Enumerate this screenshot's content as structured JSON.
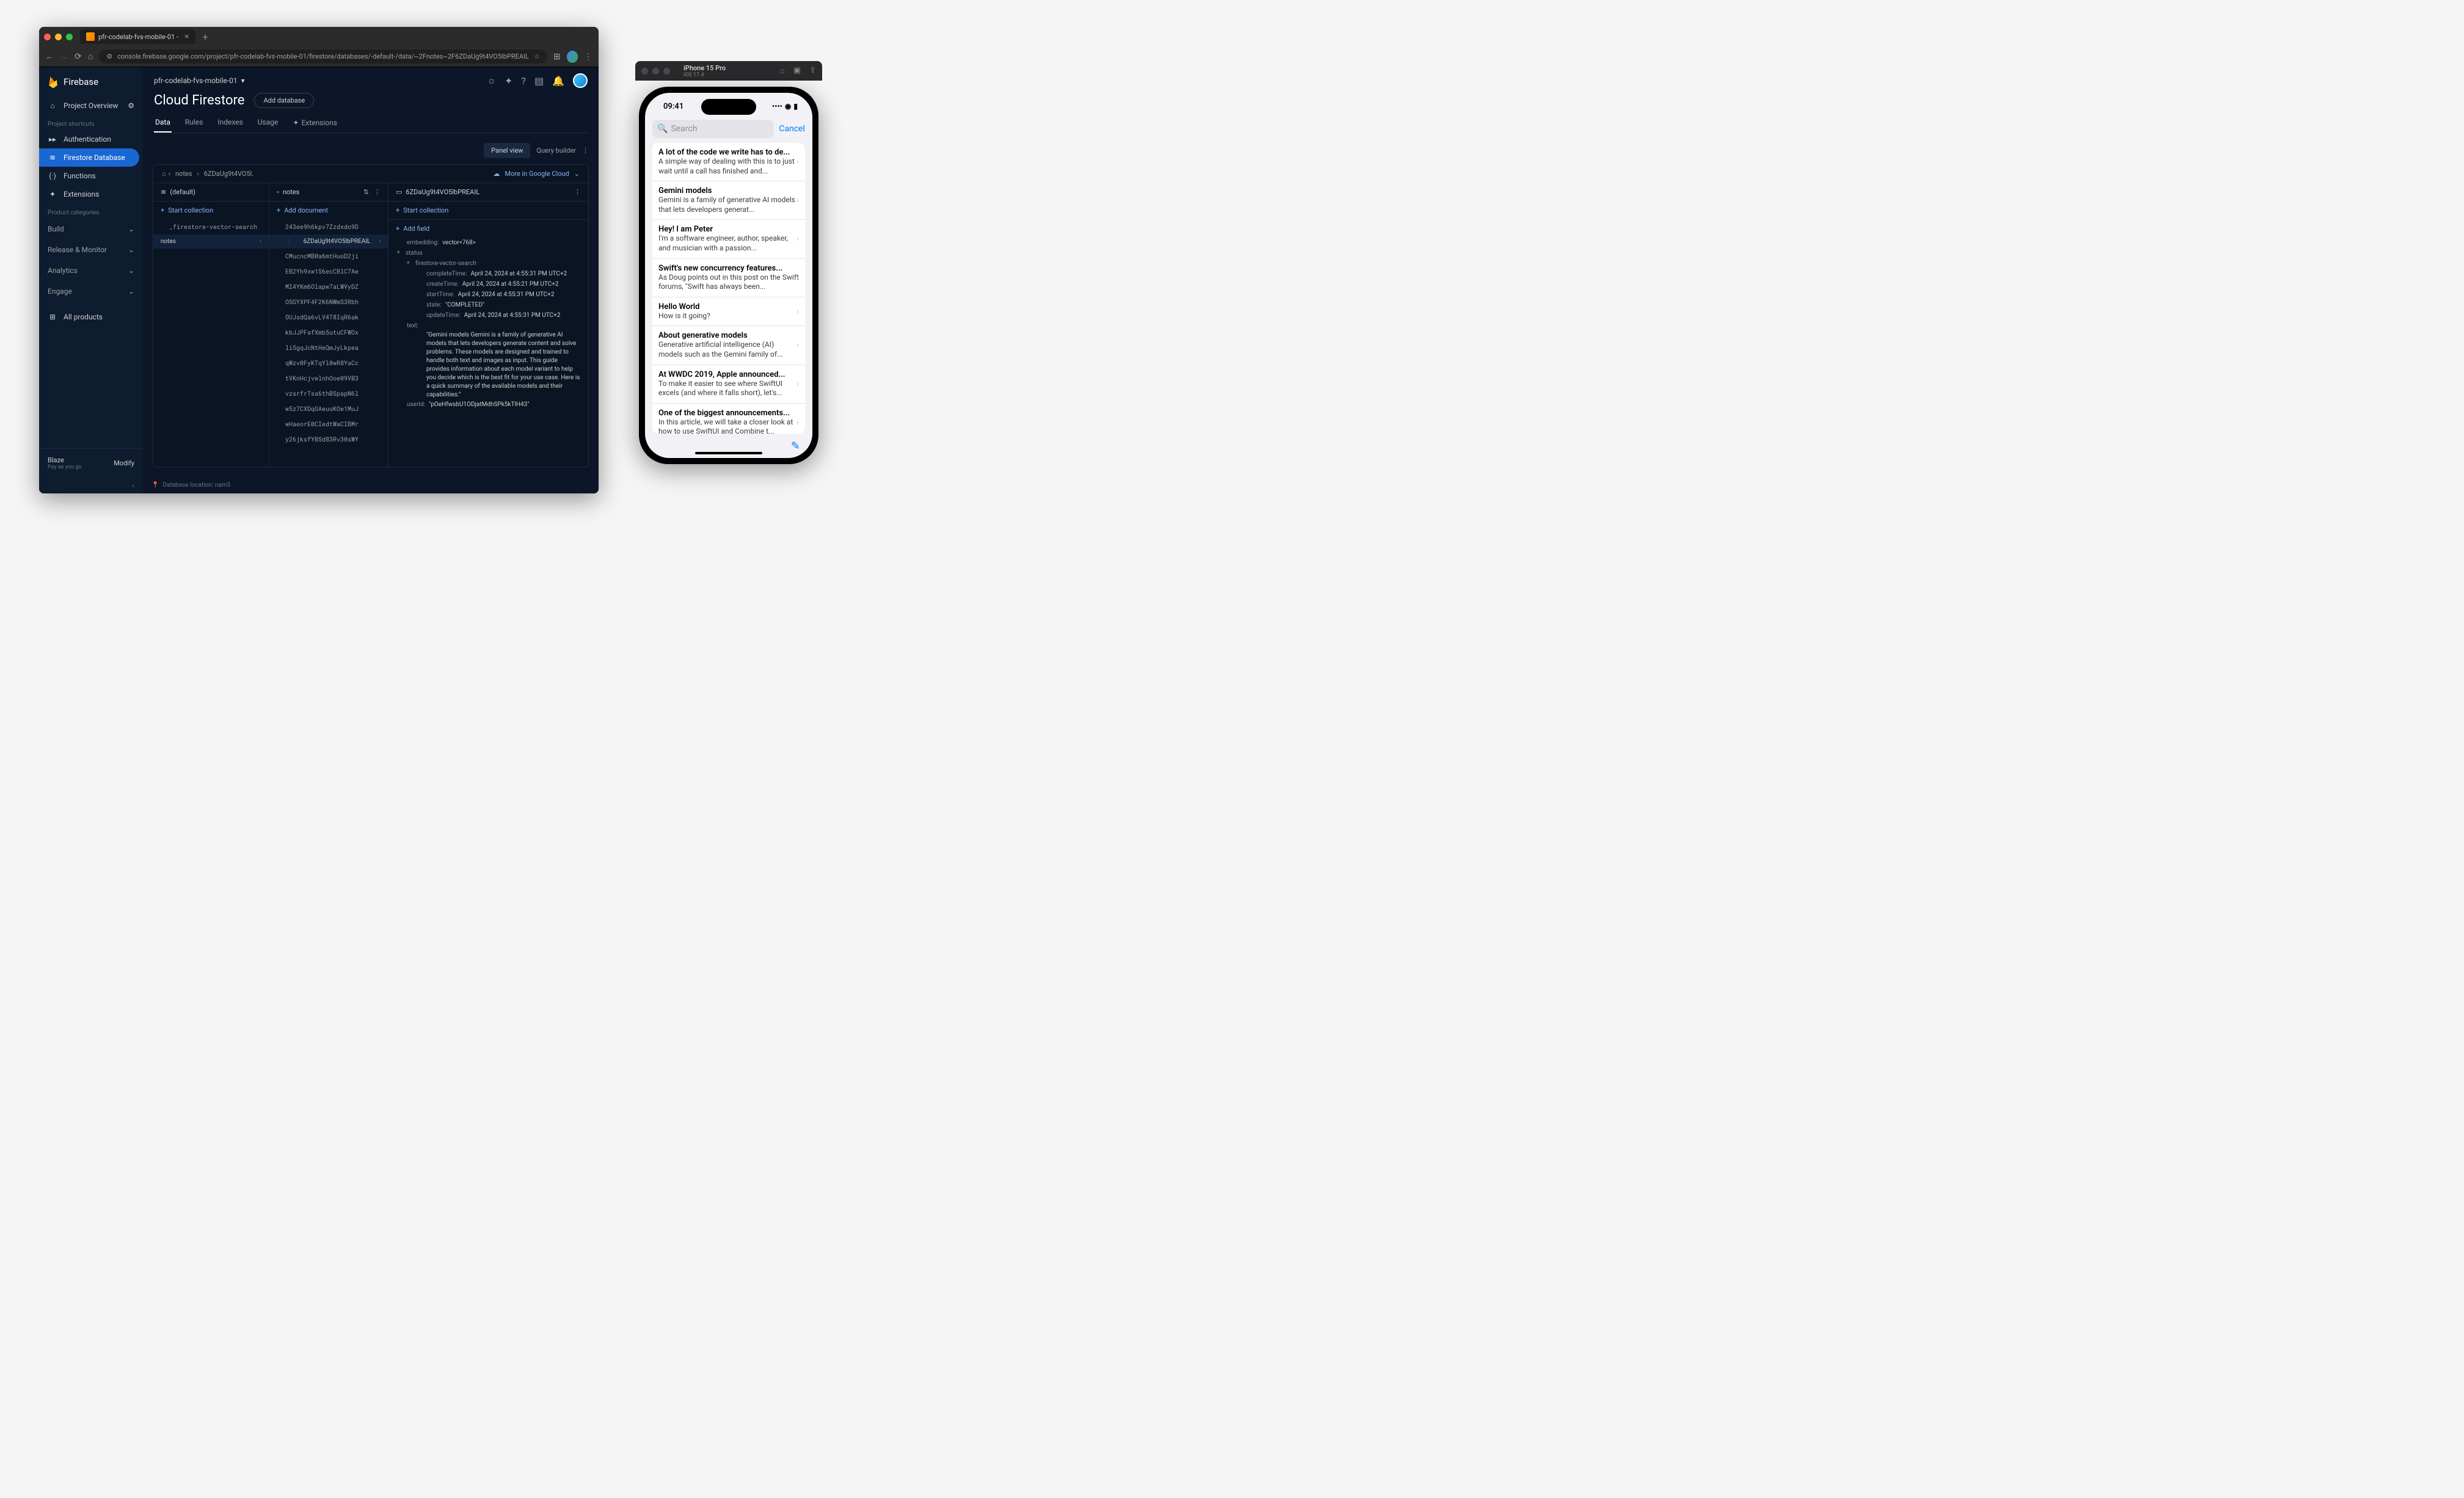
{
  "browser": {
    "tab_title": "pfr-codelab-fvs-mobile-01 - ",
    "url": "console.firebase.google.com/project/pfr-codelab-fvs-mobile-01/firestore/databases/-default-/data/~2Fnotes~2F6ZDaUg9t4VO5lbPREAIL"
  },
  "sidebar": {
    "brand": "Firebase",
    "overview": "Project Overview",
    "shortcuts_label": "Project shortcuts",
    "items": [
      {
        "icon": "👥",
        "label": "Authentication"
      },
      {
        "icon": "≋",
        "label": "Firestore Database"
      },
      {
        "icon": "(·)",
        "label": "Functions"
      },
      {
        "icon": "✦",
        "label": "Extensions"
      }
    ],
    "categories_label": "Product categories",
    "categories": [
      "Build",
      "Release & Monitor",
      "Analytics",
      "Engage"
    ],
    "all_products": "All products",
    "plan_name": "Blaze",
    "plan_sub": "Pay as you go",
    "modify": "Modify"
  },
  "header": {
    "project_name": "pfr-codelab-fvs-mobile-01",
    "page_title": "Cloud Firestore",
    "add_db": "Add database",
    "tabs": [
      "Data",
      "Rules",
      "Indexes",
      "Usage",
      "Extensions"
    ]
  },
  "data_view": {
    "panel_view": "Panel view",
    "query_builder": "Query builder",
    "more_gcloud": "More in Google Cloud",
    "breadcrumb": [
      "notes",
      "6ZDaUg9t4VO5l."
    ],
    "col0": {
      "header": "(default)",
      "action": "Start collection",
      "items": [
        "_firestore-vector-search",
        "notes"
      ]
    },
    "col1": {
      "header": "notes",
      "action": "Add document",
      "items": [
        "243ee9h6kpv7Zzdxdo9D",
        "6ZDaUg9t4VO5lbPREAIL",
        "CMucncMB0a6mtHuoD2ji",
        "EB2Yh9xw1S6ecCBlC7Ae",
        "MI4YKm6Olapw7aLWVyDZ",
        "OSGYXPF4F2K6NWmS3Rbh",
        "OUJsdQa6vLV4T8IqR6ak",
        "kbJJPFafXmb5utuCFWOx",
        "li5gqJcNtHeQmJyLkpea",
        "qWzv0FyKTqYl0wR8YaCc",
        "tVKnHcjvwlnhOoe09VB3",
        "vzsrfrTsa6thBSpapN6l",
        "w5z7CXDqGAeuuKOe1MuJ",
        "wHaeorE0CIedtWaCIBMr",
        "y26jksfYBSd83Rv30sWY"
      ]
    },
    "col2": {
      "header": "6ZDaUg9t4VO5lbPREAIL",
      "action_collection": "Start collection",
      "action_field": "Add field",
      "fields": {
        "embedding": "vector<768>",
        "status_label": "status",
        "vector_search_label": "firestore-vector-search",
        "completeTime": "April 24, 2024 at 4:55:31 PM UTC+2",
        "createTime": "April 24, 2024 at 4:55:21 PM UTC+2",
        "startTime": "April 24, 2024 at 4:55:31 PM UTC+2",
        "state": "\"COMPLETED\"",
        "updateTime": "April 24, 2024 at 4:55:31 PM UTC+2",
        "text": "\"Gemini models Gemini is a family of generative AI models that lets developers generate content and solve problems. These models are designed and trained to handle both text and images as input. This guide provides information about each model variant to help you decide which is the best fit for your use case. Here is a quick summary of the available models and their capabilities:\"",
        "userId": "\"pOeHfwsbU1ODjatMdhSPk5kTlH43\""
      }
    },
    "footer_location": "Database location: nam5"
  },
  "simulator": {
    "title": "iPhone 15 Pro",
    "subtitle": "iOS 17.4",
    "time": "09:41",
    "search_placeholder": "Search",
    "cancel": "Cancel",
    "notes": [
      {
        "title": "A lot of the code we write has to de...",
        "body": "A simple way of dealing with this is to just wait until a call has finished and..."
      },
      {
        "title": "Gemini models",
        "body": "Gemini is a family of generative AI models that lets developers generat..."
      },
      {
        "title": "Hey! I am Peter",
        "body": "I'm a software engineer, author, speaker, and musician with a passion..."
      },
      {
        "title": "Swift's new concurrency features...",
        "body": "As Doug points out in this post on the Swift forums, \"Swift has always been..."
      },
      {
        "title": "Hello World",
        "body": "How is it going?"
      },
      {
        "title": "About generative models",
        "body": "Generative artificial intelligence (AI) models such as the Gemini family of..."
      },
      {
        "title": "At WWDC 2019, Apple announced...",
        "body": "To make it easier to see where SwiftUI excels (and where it falls short), let's..."
      },
      {
        "title": "One of the biggest announcements...",
        "body": "In this article, we will take a closer look at how to use SwiftUI and Combine t..."
      }
    ]
  }
}
